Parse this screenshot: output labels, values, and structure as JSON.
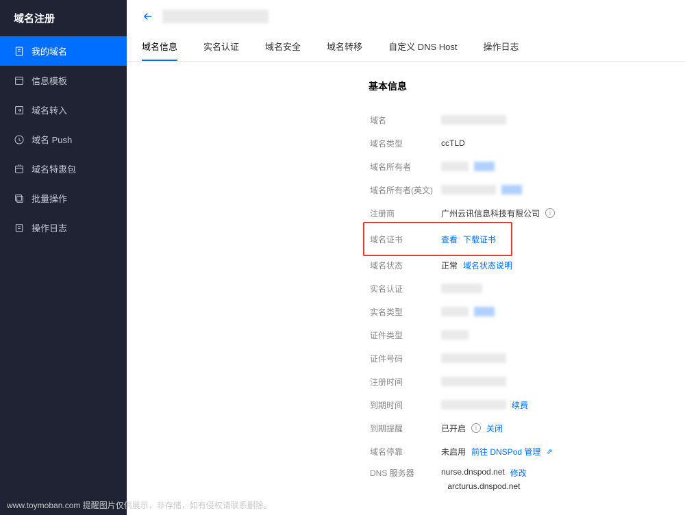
{
  "sidebar": {
    "title": "域名注册",
    "items": [
      {
        "label": "我的域名",
        "icon": "document"
      },
      {
        "label": "信息模板",
        "icon": "template"
      },
      {
        "label": "域名转入",
        "icon": "transfer"
      },
      {
        "label": "域名 Push",
        "icon": "push"
      },
      {
        "label": "域名特惠包",
        "icon": "package"
      },
      {
        "label": "批量操作",
        "icon": "batch"
      },
      {
        "label": "操作日志",
        "icon": "log"
      }
    ]
  },
  "tabs": [
    "域名信息",
    "实名认证",
    "域名安全",
    "域名转移",
    "自定义 DNS Host",
    "操作日志"
  ],
  "section_title": "基本信息",
  "info": {
    "domain_label": "域名",
    "domain_type_label": "域名类型",
    "domain_type_value": "ccTLD",
    "owner_label": "域名所有者",
    "owner_en_label": "域名所有者(英文)",
    "registrar_label": "注册商",
    "registrar_value": "广州云讯信息科技有限公司",
    "cert_label": "域名证书",
    "cert_view": "查看",
    "cert_download": "下载证书",
    "status_label": "域名状态",
    "status_value": "正常",
    "status_link": "域名状态说明",
    "realname_label": "实名认证",
    "realname_type_label": "实名类型",
    "cert_type_label": "证件类型",
    "cert_num_label": "证件号码",
    "reg_time_label": "注册时间",
    "expire_time_label": "到期时间",
    "renew_link": "续费",
    "remind_label": "到期提醒",
    "remind_value": "已开启",
    "remind_close": "关闭",
    "parking_label": "域名停靠",
    "parking_value": "未启用",
    "parking_link": "前往 DNSPod 管理",
    "dns_label": "DNS 服务器",
    "dns1": "nurse.dnspod.net",
    "dns2": "arcturus.dnspod.net",
    "dns_modify": "修改"
  },
  "watermark": "www.toymoban.com 提醒图片仅供展示，非存储，如有侵权请联系删除。"
}
